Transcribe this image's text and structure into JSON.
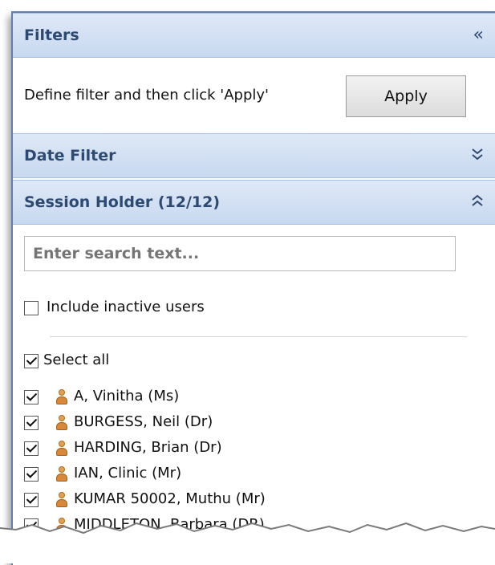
{
  "filters": {
    "title": "Filters",
    "collapse_icon": "«",
    "instruction": "Define filter and then click 'Apply'",
    "apply_label": "Apply"
  },
  "date_filter": {
    "title": "Date Filter",
    "expand_icon": "≫"
  },
  "session_holder": {
    "title": "Session Holder (12/12)",
    "collapse_icon": "≪",
    "search_placeholder": "Enter search text...",
    "include_inactive_label": "Include inactive users",
    "include_inactive_checked": false,
    "select_all_label": "Select all",
    "select_all_checked": true,
    "users": [
      {
        "name": "A, Vinitha (Ms)",
        "checked": true
      },
      {
        "name": "BURGESS, Neil (Dr)",
        "checked": true
      },
      {
        "name": "HARDING, Brian (Dr)",
        "checked": true
      },
      {
        "name": "IAN, Clinic (Mr)",
        "checked": true
      },
      {
        "name": "KUMAR 50002, Muthu (Mr)",
        "checked": true
      },
      {
        "name": "MIDDLETON, Barbara (DR)",
        "checked": true
      }
    ]
  }
}
